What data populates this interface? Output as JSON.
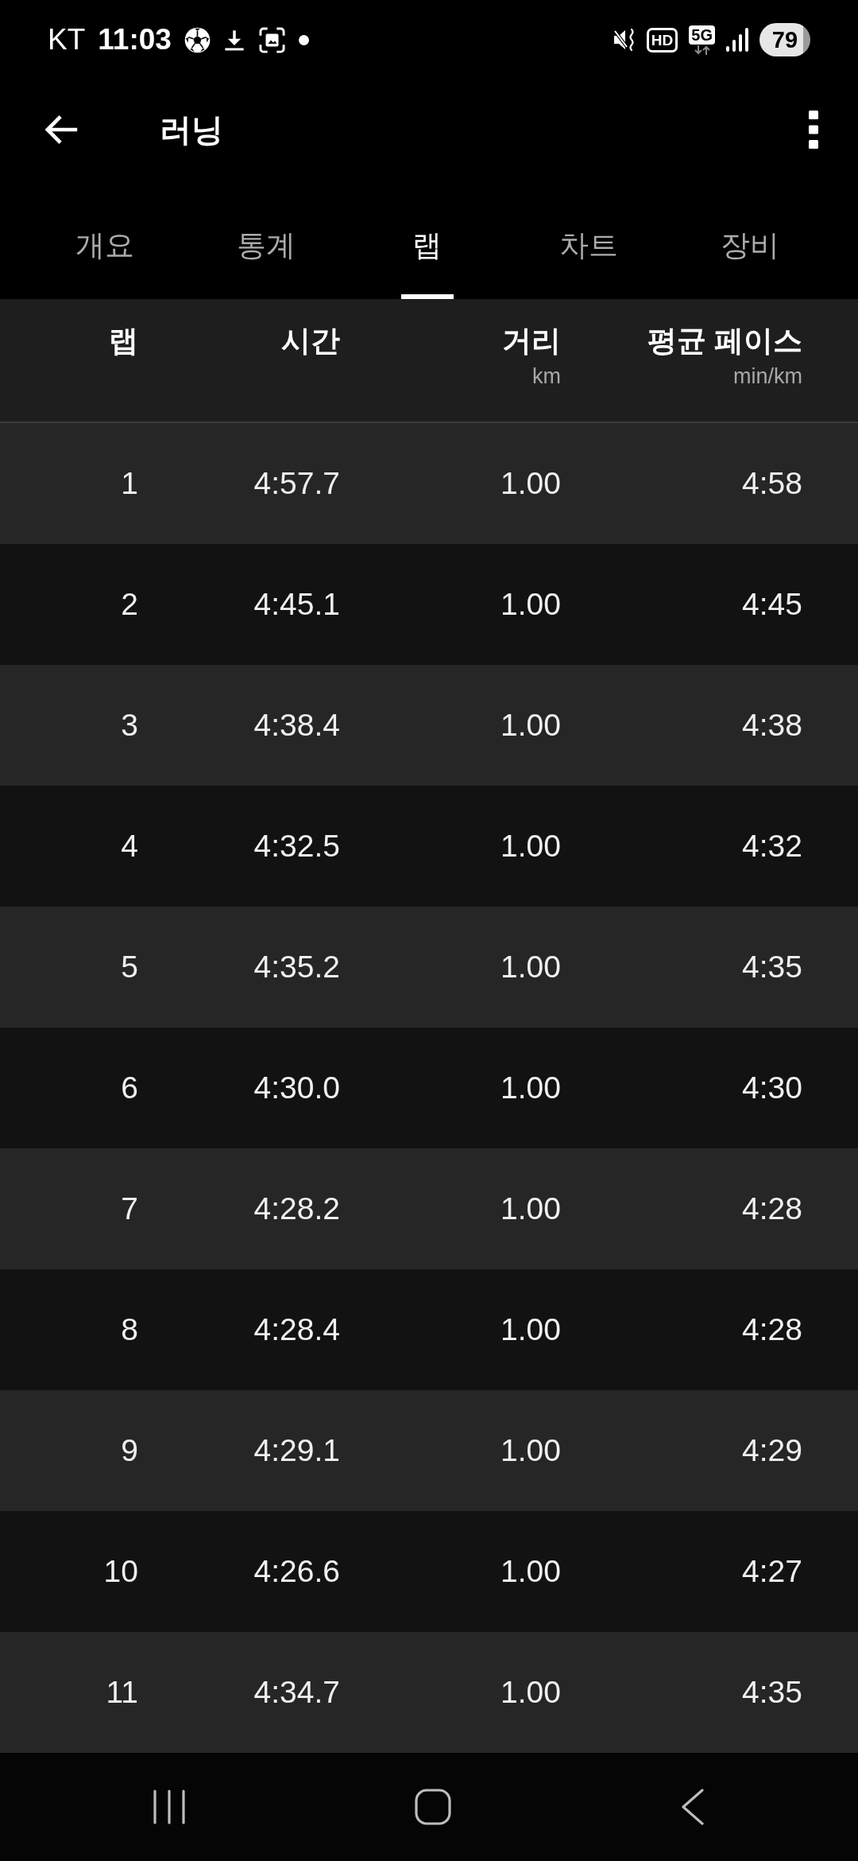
{
  "status_bar": {
    "carrier": "KT",
    "time": "11:03",
    "hd_label": "HD",
    "network_label": "5G",
    "battery": "79"
  },
  "app_bar": {
    "title": "러닝"
  },
  "tabs": [
    {
      "label": "개요",
      "selected": false
    },
    {
      "label": "통계",
      "selected": false
    },
    {
      "label": "랩",
      "selected": true
    },
    {
      "label": "차트",
      "selected": false
    },
    {
      "label": "장비",
      "selected": false
    }
  ],
  "table": {
    "columns": [
      {
        "label": "랩"
      },
      {
        "label": "시간"
      },
      {
        "label": "거리",
        "unit": "km"
      },
      {
        "label": "평균 페이스",
        "unit": "min/km"
      }
    ],
    "rows": [
      [
        "1",
        "4:57.7",
        "1.00",
        "4:58"
      ],
      [
        "2",
        "4:45.1",
        "1.00",
        "4:45"
      ],
      [
        "3",
        "4:38.4",
        "1.00",
        "4:38"
      ],
      [
        "4",
        "4:32.5",
        "1.00",
        "4:32"
      ],
      [
        "5",
        "4:35.2",
        "1.00",
        "4:35"
      ],
      [
        "6",
        "4:30.0",
        "1.00",
        "4:30"
      ],
      [
        "7",
        "4:28.2",
        "1.00",
        "4:28"
      ],
      [
        "8",
        "4:28.4",
        "1.00",
        "4:28"
      ],
      [
        "9",
        "4:29.1",
        "1.00",
        "4:29"
      ],
      [
        "10",
        "4:26.6",
        "1.00",
        "4:27"
      ],
      [
        "11",
        "4:34.7",
        "1.00",
        "4:35"
      ]
    ]
  }
}
